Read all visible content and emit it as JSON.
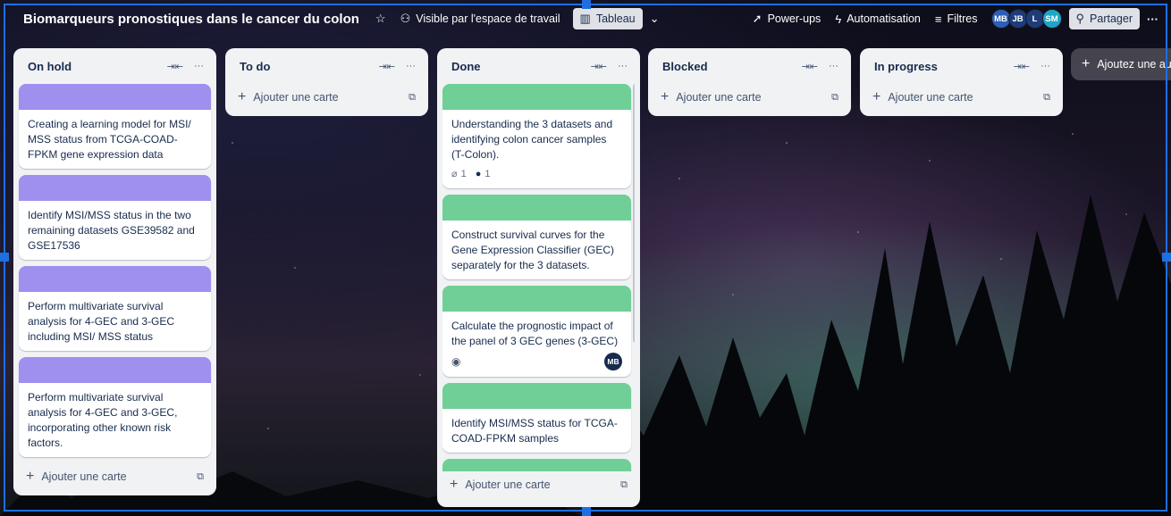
{
  "header": {
    "board_title": "Biomarqueurs pronostiques dans le cancer du colon",
    "visibility_label": "Visible par l'espace de travail",
    "view_label": "Tableau",
    "powerups_label": "Power-ups",
    "automation_label": "Automatisation",
    "filters_label": "Filtres",
    "members": [
      {
        "initials": "MB",
        "color": "#2b5fb8"
      },
      {
        "initials": "JB",
        "color": "#1d3c78"
      },
      {
        "initials": "L",
        "color": "#1d3c78"
      },
      {
        "initials": "SM",
        "color": "#1ea7c5"
      }
    ],
    "share_label": "Partager"
  },
  "colors": {
    "purple_cover": "#9f8fef",
    "green_cover": "#6fcf97",
    "selection": "#1f6fe0"
  },
  "lists": [
    {
      "title": "On hold",
      "add_label": "Ajouter une carte",
      "cards": [
        {
          "text": "Creating a learning model for MSI/ MSS status from TCGA-COAD-FPKM gene expression data"
        },
        {
          "text": "Identify MSI/MSS status in the two remaining datasets GSE39582 and GSE17536"
        },
        {
          "text": "Perform multivariate survival analysis for 4-GEC and 3-GEC including MSI/ MSS status"
        },
        {
          "text": "Perform multivariate survival analysis for 4-GEC and 3-GEC, incorporating other known risk factors."
        }
      ]
    },
    {
      "title": "To do",
      "add_label": "Ajouter une carte",
      "cards": []
    },
    {
      "title": "Done",
      "add_label": "Ajouter une carte",
      "cards": [
        {
          "text": "Understanding the 3 datasets and identifying colon cancer samples (T-Colon).",
          "attachments": "1",
          "github": "1"
        },
        {
          "text": "Construct survival curves for the Gene Expression Classifier (GEC) separately for the 3 datasets."
        },
        {
          "text": "Calculate the prognostic impact of the panel of 3 GEC genes (3-GEC)",
          "member": "MB"
        },
        {
          "text": "Identify MSI/MSS status for TCGA-COAD-FPKM samples"
        },
        {
          "text": ""
        }
      ]
    },
    {
      "title": "Blocked",
      "add_label": "Ajouter une carte",
      "cards": []
    },
    {
      "title": "In progress",
      "add_label": "Ajouter une carte",
      "cards": []
    }
  ],
  "add_list_label": "Ajoutez une au"
}
